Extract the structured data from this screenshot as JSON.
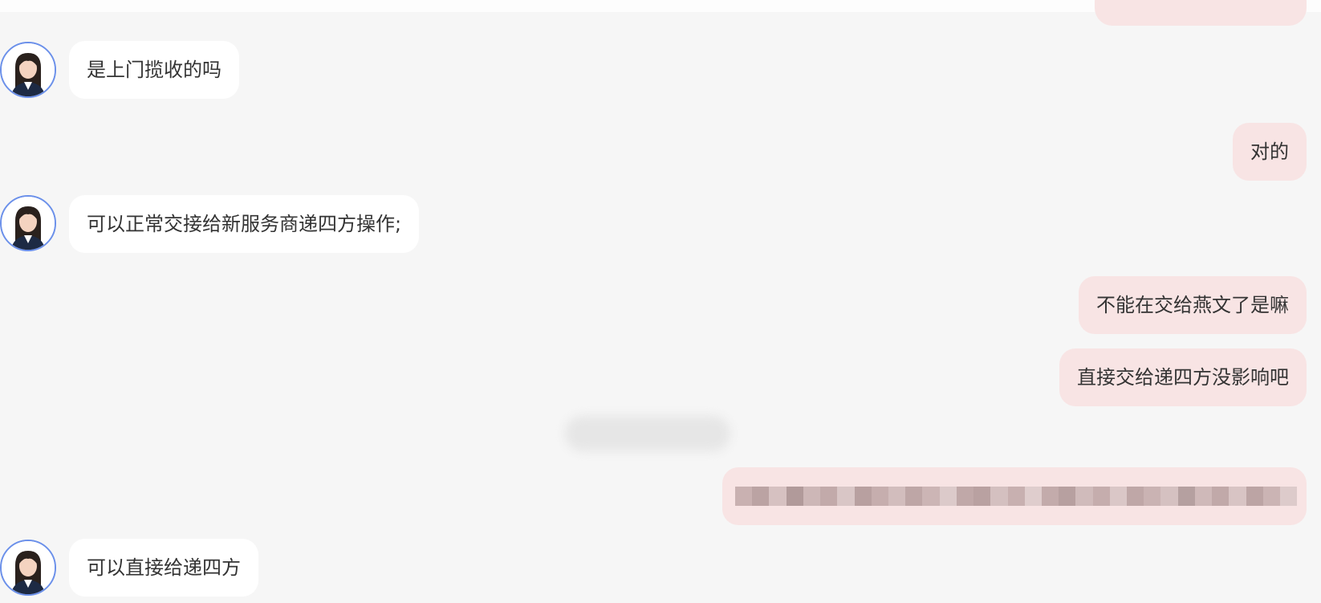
{
  "conversation": {
    "messages": [
      {
        "sender": "agent",
        "text": "是上门揽收的吗"
      },
      {
        "sender": "user",
        "text": "对的"
      },
      {
        "sender": "agent",
        "text": "可以正常交接给新服务商递四方操作;"
      },
      {
        "sender": "user",
        "text": "不能在交给燕文了是嘛"
      },
      {
        "sender": "user",
        "text": "直接交给递四方没影响吧"
      },
      {
        "sender": "user",
        "text": ""
      },
      {
        "sender": "agent",
        "text": "可以直接给递四方"
      }
    ]
  },
  "icons": {
    "agent_avatar": "agent-avatar-photo"
  },
  "colors": {
    "background": "#f6f6f6",
    "agent_bubble": "#ffffff",
    "user_bubble": "#f8e4e4",
    "avatar_border": "#6b90ea",
    "text": "#333333"
  }
}
